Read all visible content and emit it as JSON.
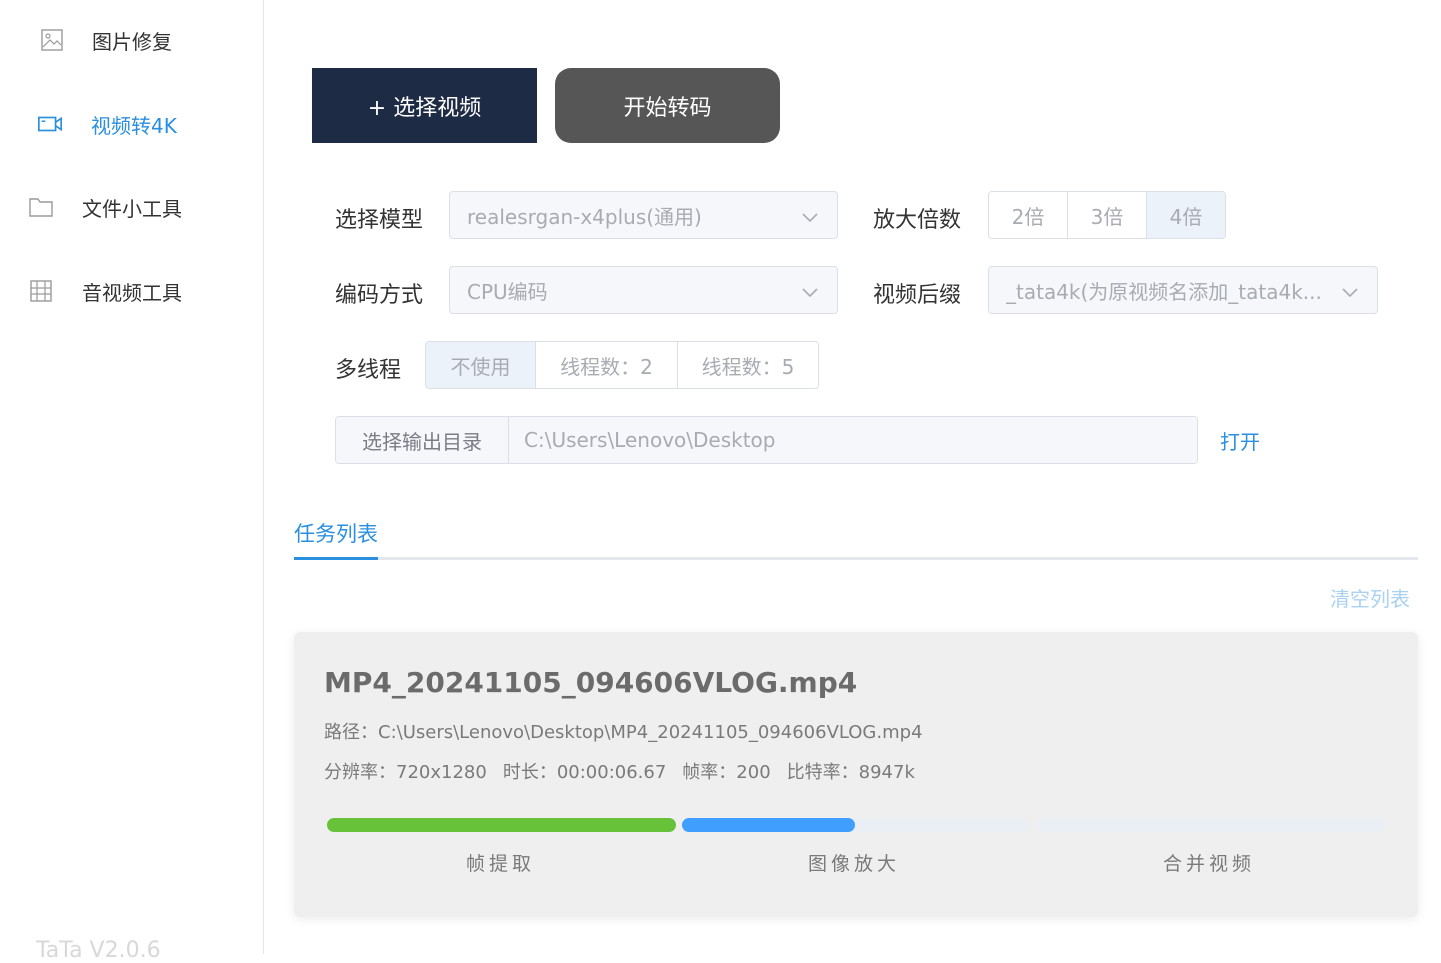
{
  "sidebar": {
    "items": [
      {
        "label": "图片修复",
        "icon": "image-icon",
        "active": false
      },
      {
        "label": "视频转4K",
        "icon": "video-camera-icon",
        "active": true
      },
      {
        "label": "文件小工具",
        "icon": "folder-icon",
        "active": false
      },
      {
        "label": "音视频工具",
        "icon": "film-grid-icon",
        "active": false
      }
    ],
    "version": "TaTa V2.0.6"
  },
  "toolbar": {
    "select_video_label": "+ 选择视频",
    "start_label": "开始转码"
  },
  "form": {
    "model_label": "选择模型",
    "model_value": "realesrgan-x4plus(通用)",
    "scale_label": "放大倍数",
    "scale_options": [
      "2倍",
      "3倍",
      "4倍"
    ],
    "scale_selected": "4倍",
    "encoder_label": "编码方式",
    "encoder_value": "CPU编码",
    "suffix_label": "视频后缀",
    "suffix_value": "_tata4k(为原视频名添加_tata4k...",
    "thread_label": "多线程",
    "thread_options": [
      "不使用",
      "线程数：2",
      "线程数：5"
    ],
    "thread_selected": "不使用",
    "output_button": "选择输出目录",
    "output_path": "C:\\Users\\Lenovo\\Desktop",
    "open_link": "打开"
  },
  "tasks": {
    "tab_label": "任务列表",
    "clear_label": "清空列表",
    "items": [
      {
        "file_name": "MP4_20241105_094606VLOG.mp4",
        "path": "路径：C:\\Users\\Lenovo\\Desktop\\MP4_20241105_094606VLOG.mp4",
        "resolution": "分辨率：720x1280",
        "duration": "时长：00:00:06.67",
        "fps": "帧率：200",
        "bitrate": "比特率：8947k",
        "stages": [
          {
            "label": "帧提取",
            "progress": 1.0,
            "color": "#67c23a"
          },
          {
            "label": "图像放大",
            "progress": 0.5,
            "color": "#409eff"
          },
          {
            "label": "合并视频",
            "progress": 0.0,
            "color": "#409eff"
          }
        ]
      }
    ]
  },
  "colors": {
    "accent": "#2b8fe0",
    "primary_button": "#1e2b44",
    "start_button": "#565656",
    "success": "#67c23a",
    "progress": "#409eff"
  }
}
